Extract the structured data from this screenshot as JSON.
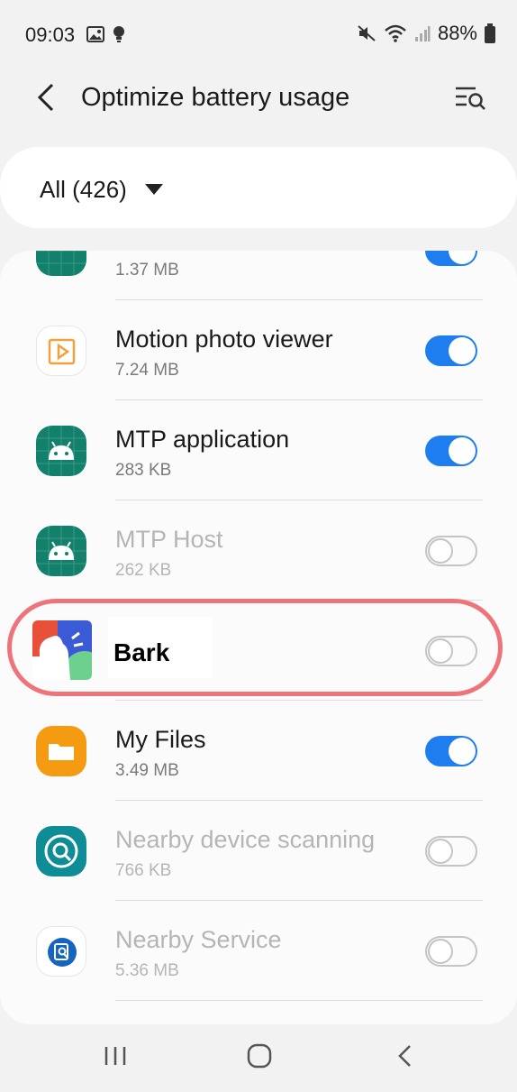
{
  "status_bar": {
    "time": "09:03",
    "battery_percent": "88%",
    "icons": [
      "image-icon",
      "lightbulb-icon",
      "mute-icon",
      "wifi-icon",
      "signal-icon",
      "battery-icon"
    ]
  },
  "header": {
    "title": "Optimize battery usage",
    "back_icon": "back-arrow-icon",
    "search_icon": "list-search-icon"
  },
  "filter": {
    "label": "All (426)"
  },
  "apps": [
    {
      "name": "",
      "size": "1.37 MB",
      "icon": "android-icon",
      "enabled": true
    },
    {
      "name": "Motion photo viewer",
      "size": "7.24 MB",
      "icon": "motion-photo-icon",
      "enabled": true
    },
    {
      "name": "MTP application",
      "size": "283 KB",
      "icon": "android-icon",
      "enabled": true
    },
    {
      "name": "MTP Host",
      "size": "262 KB",
      "icon": "android-icon",
      "enabled": false
    },
    {
      "name": "Bark",
      "size": "",
      "icon": "bark-app-icon",
      "enabled": false
    },
    {
      "name": "My Files",
      "size": "3.49 MB",
      "icon": "folder-icon",
      "enabled": true
    },
    {
      "name": "Nearby device scanning",
      "size": "766 KB",
      "icon": "nearby-scan-icon",
      "enabled": false
    },
    {
      "name": "Nearby Service",
      "size": "5.36 MB",
      "icon": "nearby-service-icon",
      "enabled": false
    }
  ],
  "colors": {
    "toggle_on": "#1e7ef0",
    "highlight": "#ee747a",
    "android_icon_bg": "#12806b"
  },
  "navbar": {
    "recents_icon": "recents-icon",
    "home_icon": "home-icon",
    "back_icon": "nav-back-icon"
  }
}
